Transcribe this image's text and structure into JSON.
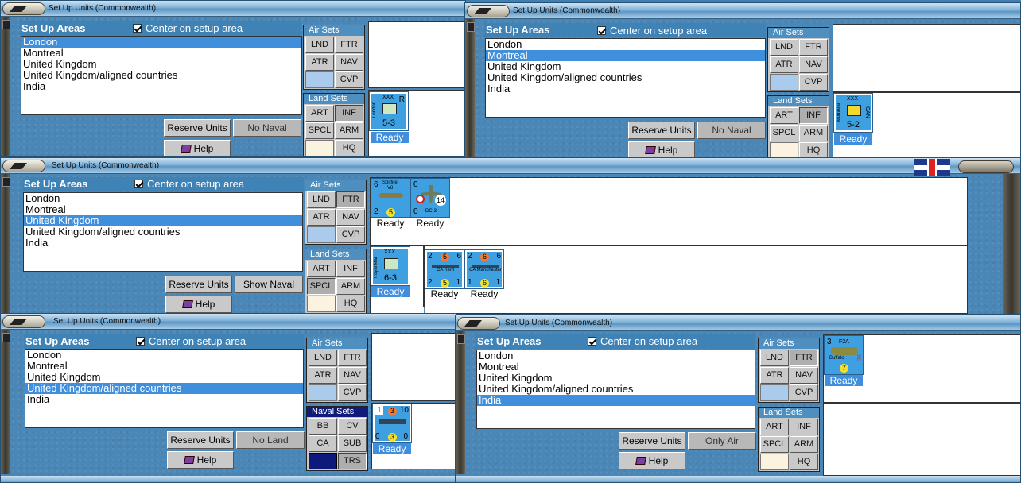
{
  "windows": [
    {
      "title": "Set Up Units (Commonwealth)",
      "header": "Set Up Areas",
      "center_label": "Center on setup area",
      "areas": [
        "London",
        "Montreal",
        "United Kingdom",
        "United Kingdom/aligned countries",
        "India"
      ],
      "selected": 0,
      "reserve": "Reserve Units",
      "toggle": "No Naval",
      "help": "Help",
      "air_title": "Air Sets",
      "air": [
        "LND",
        "FTR",
        "ATR",
        "NAV",
        "CVP"
      ],
      "land_title": "Land Sets",
      "land": [
        "ART",
        "INF",
        "SPCL",
        "ARM",
        "HQ"
      ],
      "units": [
        {
          "top": "XXX",
          "side": "London",
          "corner": "R",
          "value": "5-3",
          "status": "Ready"
        }
      ]
    },
    {
      "title": "Set Up Units (Commonwealth)",
      "header": "Set Up Areas",
      "center_label": "Center on setup area",
      "areas": [
        "London",
        "Montreal",
        "United Kingdom",
        "United Kingdom/aligned countries",
        "India"
      ],
      "selected": 1,
      "reserve": "Reserve Units",
      "toggle": "No Naval",
      "help": "Help",
      "air_title": "Air Sets",
      "air": [
        "LND",
        "FTR",
        "ATR",
        "NAV",
        "CVP"
      ],
      "land_title": "Land Sets",
      "land": [
        "ART",
        "INF",
        "SPCL",
        "ARM",
        "HQ"
      ],
      "units": [
        {
          "top": "XXX",
          "side": "Montreal",
          "corner": "CAN",
          "value": "5-2",
          "status": "Ready"
        }
      ]
    },
    {
      "title": "Set Up Units (Commonwealth)",
      "header": "Set Up Areas",
      "center_label": "Center on setup area",
      "areas": [
        "London",
        "Montreal",
        "United Kingdom",
        "United Kingdom/aligned countries",
        "India"
      ],
      "selected": 2,
      "reserve": "Reserve Units",
      "toggle": "Show Naval",
      "help": "Help",
      "air_title": "Air Sets",
      "air": [
        "LND",
        "FTR",
        "ATR",
        "NAV",
        "CVP"
      ],
      "land_title": "Land Sets",
      "land": [
        "ART",
        "INF",
        "SPCL",
        "ARM",
        "HQ"
      ],
      "air_units": [
        {
          "name": "Spitfire",
          "sub": "V8",
          "tl": "6",
          "bl": "2",
          "mid": "5",
          "status": "Ready"
        },
        {
          "name": "DC-3",
          "tl": "0",
          "bl": "0",
          "mid": "14",
          "status": "Ready"
        }
      ],
      "land_units": [
        {
          "top": "XXX",
          "side": "Royal Mar",
          "value": "6-3",
          "status": "Ready"
        }
      ],
      "naval_units": [
        {
          "name": "CA Kent",
          "a": "2",
          "b": "5",
          "c": "6",
          "d": "2",
          "e": "5",
          "f": "1",
          "status": "Ready"
        },
        {
          "name": "CA Manchester",
          "a": "2",
          "b": "6",
          "c": "6",
          "d": "1",
          "e": "6",
          "f": "1",
          "status": "Ready"
        }
      ]
    },
    {
      "title": "Set Up Units (Commonwealth)",
      "header": "Set Up Areas",
      "center_label": "Center on setup area",
      "areas": [
        "London",
        "Montreal",
        "United Kingdom",
        "United Kingdom/aligned countries",
        "India"
      ],
      "selected": 3,
      "reserve": "Reserve Units",
      "toggle": "No Land",
      "help": "Help",
      "air_title": "Air Sets",
      "air": [
        "LND",
        "FTR",
        "ATR",
        "NAV",
        "CVP"
      ],
      "naval_title": "Naval Sets",
      "naval": [
        "BB",
        "CV",
        "CA",
        "SUB",
        "TRS"
      ],
      "units": [
        {
          "a": "1",
          "b": "3",
          "c": "10",
          "d": "0",
          "e": "3",
          "f": "0",
          "status": "Ready"
        }
      ]
    },
    {
      "title": "Set Up Units (Commonwealth)",
      "header": "Set Up Areas",
      "center_label": "Center on setup area",
      "areas": [
        "London",
        "Montreal",
        "United Kingdom",
        "United Kingdom/aligned countries",
        "India"
      ],
      "selected": 4,
      "reserve": "Reserve Units",
      "toggle": "Only Air",
      "help": "Help",
      "air_title": "Air Sets",
      "air": [
        "LND",
        "FTR",
        "ATR",
        "NAV",
        "CVP"
      ],
      "land_title": "Land Sets",
      "land": [
        "ART",
        "INF",
        "SPCL",
        "ARM",
        "HQ"
      ],
      "units": [
        {
          "tl": "3",
          "name": "F2A",
          "sub": "Buffalo",
          "corner": "IND",
          "mid": "7",
          "status": "Ready"
        }
      ]
    }
  ],
  "colors": {
    "selection": "#3f8fdc",
    "header": "#3f82b6",
    "water": "#4a86b6"
  }
}
